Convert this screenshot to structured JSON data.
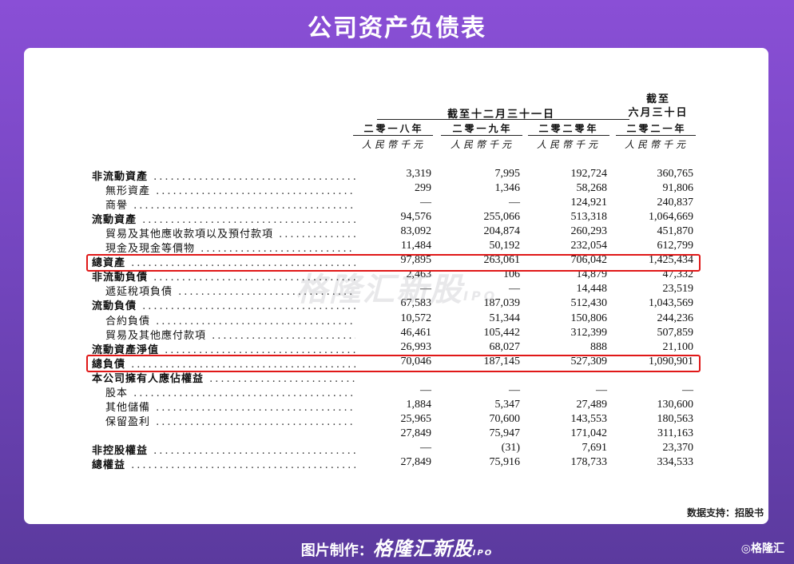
{
  "title": "公司资产负债表",
  "header": {
    "period_label": "截至十二月三十一日",
    "june_line1": "截至",
    "june_line2": "六月三十日",
    "years": [
      "二零一八年",
      "二零一九年",
      "二零二零年",
      "二零二一年"
    ],
    "unit": "人民幣千元"
  },
  "rows": [
    {
      "label": "非流動資產",
      "bold": true,
      "values": [
        "3,319",
        "7,995",
        "192,724",
        "360,765"
      ]
    },
    {
      "label": "無形資產",
      "bold": false,
      "values": [
        "299",
        "1,346",
        "58,268",
        "91,806"
      ]
    },
    {
      "label": "商譽",
      "bold": false,
      "values": [
        "—",
        "—",
        "124,921",
        "240,837"
      ]
    },
    {
      "label": "流動資產",
      "bold": true,
      "values": [
        "94,576",
        "255,066",
        "513,318",
        "1,064,669"
      ]
    },
    {
      "label": "貿易及其他應收款項以及預付款項",
      "bold": false,
      "values": [
        "83,092",
        "204,874",
        "260,293",
        "451,870"
      ]
    },
    {
      "label": "現金及現金等價物",
      "bold": false,
      "values": [
        "11,484",
        "50,192",
        "232,054",
        "612,799"
      ]
    },
    {
      "label": "總資產",
      "bold": true,
      "values": [
        "97,895",
        "263,061",
        "706,042",
        "1,425,434"
      ]
    },
    {
      "label": "非流動負債",
      "bold": true,
      "values": [
        "2,463",
        "106",
        "14,879",
        "47,332"
      ]
    },
    {
      "label": "遞延稅項負債",
      "bold": false,
      "values": [
        "—",
        "—",
        "14,448",
        "23,519"
      ]
    },
    {
      "label": "流動負債",
      "bold": true,
      "values": [
        "67,583",
        "187,039",
        "512,430",
        "1,043,569"
      ]
    },
    {
      "label": "合約負債",
      "bold": false,
      "values": [
        "10,572",
        "51,344",
        "150,806",
        "244,236"
      ]
    },
    {
      "label": "貿易及其他應付款項",
      "bold": false,
      "values": [
        "46,461",
        "105,442",
        "312,399",
        "507,859"
      ]
    },
    {
      "label": "流動資產淨值",
      "bold": true,
      "values": [
        "26,993",
        "68,027",
        "888",
        "21,100"
      ]
    },
    {
      "label": "總負債",
      "bold": true,
      "values": [
        "70,046",
        "187,145",
        "527,309",
        "1,090,901"
      ]
    },
    {
      "label": "本公司擁有人應佔權益",
      "bold": true,
      "values": [
        "",
        "",
        "",
        ""
      ]
    },
    {
      "label": "股本",
      "bold": false,
      "values": [
        "—",
        "—",
        "—",
        "—"
      ]
    },
    {
      "label": "其他儲備",
      "bold": false,
      "values": [
        "1,884",
        "5,347",
        "27,489",
        "130,600"
      ]
    },
    {
      "label": "保留盈利",
      "bold": false,
      "values": [
        "25,965",
        "70,600",
        "143,553",
        "180,563"
      ]
    },
    {
      "label": "",
      "bold": false,
      "values": [
        "27,849",
        "75,947",
        "171,042",
        "311,163"
      ]
    },
    {
      "label": "非控股權益",
      "bold": true,
      "values": [
        "—",
        "(31)",
        "7,691",
        "23,370"
      ]
    },
    {
      "label": "總權益",
      "bold": true,
      "values": [
        "27,849",
        "75,916",
        "178,733",
        "334,533"
      ]
    }
  ],
  "watermark": {
    "brand": "格隆汇新股",
    "suffix": "IPO"
  },
  "source": "数据支持：招股书",
  "footer": {
    "prefix": "图片制作：",
    "brand": "格隆汇新股",
    "suffix": "IPO"
  },
  "corner_logo": "格隆汇",
  "colors": {
    "highlight": "#e01818",
    "background": "#7a48c8"
  }
}
